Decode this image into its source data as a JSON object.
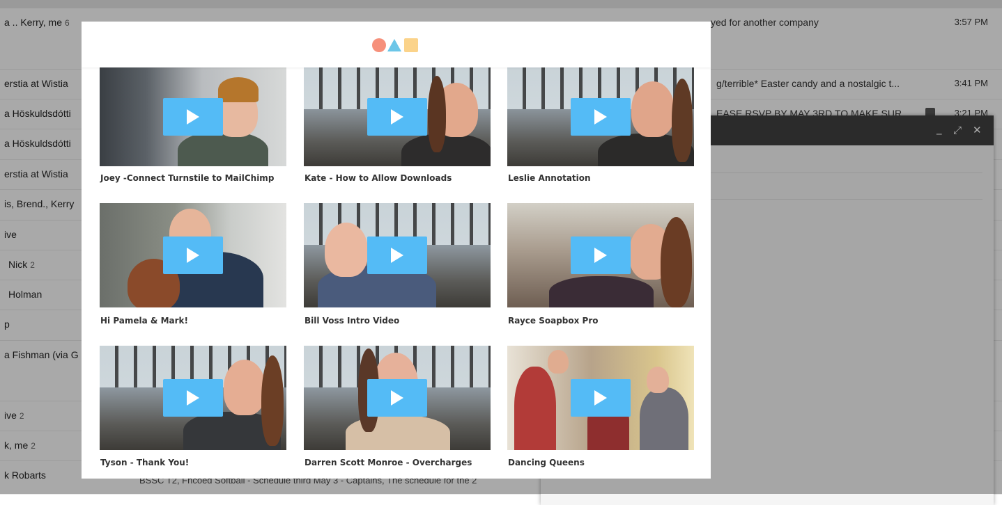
{
  "inbox": {
    "rows": [
      {
        "sender": "a .. Kerry, me",
        "count": "6",
        "subject": "yed for another company",
        "time": "3:57 PM",
        "tall": true
      },
      {
        "sender": "erstia at Wistia",
        "count": "",
        "subject": "g/terrible* Easter candy and a nostalgic t...",
        "time": "3:41 PM"
      },
      {
        "sender": "a Höskuldsdótti",
        "count": "",
        "subject": "EASE RSVP BY MAY 3RD TO MAKE SUR...",
        "time": "3:21 PM",
        "calendar": true
      },
      {
        "sender": "a Höskuldsdótti",
        "count": "",
        "subject": "",
        "time": ""
      },
      {
        "sender": "erstia at Wistia",
        "count": "",
        "subject": "",
        "time": ""
      },
      {
        "sender": "is, Brend., Kerry",
        "count": "",
        "subject": "",
        "time": ""
      },
      {
        "sender": "ive",
        "count": "",
        "subject": "",
        "time": ""
      },
      {
        "sender": "Nick",
        "count": "2",
        "subject": "",
        "time": ""
      },
      {
        "sender": "Holman",
        "count": "",
        "subject": "",
        "time": ""
      },
      {
        "sender": "p",
        "count": "",
        "subject": "",
        "time": ""
      },
      {
        "sender": "a Fishman (via G",
        "count": "",
        "subject": "",
        "time": "",
        "tall": true
      },
      {
        "sender": "ive",
        "count": "2",
        "subject": "",
        "time": ""
      },
      {
        "sender": "k, me",
        "count": "2",
        "subject": "",
        "time": ""
      },
      {
        "sender": "k Robarts",
        "count": "",
        "subject": "BSSC T2, Fncoed Softball - Schedule third May 3 - Captains, The schedule for the 2",
        "time": ""
      }
    ]
  },
  "compose": {
    "minimize_icon": "_",
    "expand_icon": "⤢",
    "close_icon": "✕"
  },
  "modal": {
    "logo_colors": {
      "circle": "#f6907b",
      "triangle": "#6cc6e8",
      "square": "#fbd38a"
    },
    "play_color": "#54bbf6",
    "videos": [
      {
        "title": "Joey -Connect Turnstile to MailChimp"
      },
      {
        "title": "Kate - How to Allow Downloads"
      },
      {
        "title": "Leslie Annotation"
      },
      {
        "title": "Hi Pamela & Mark!"
      },
      {
        "title": "Bill Voss Intro Video"
      },
      {
        "title": "Rayce Soapbox Pro"
      },
      {
        "title": "Tyson - Thank You!"
      },
      {
        "title": "Darren Scott Monroe - Overcharges"
      },
      {
        "title": "Dancing Queens"
      }
    ]
  }
}
